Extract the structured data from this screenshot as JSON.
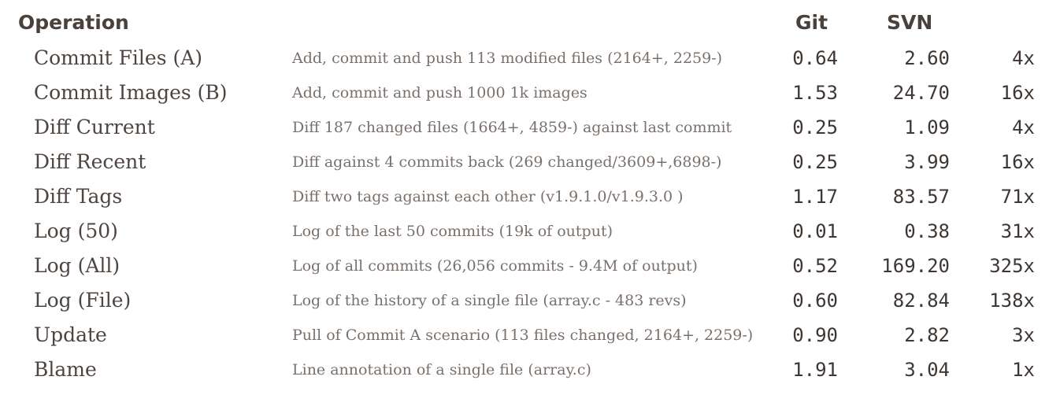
{
  "header": {
    "operation": "Operation",
    "git": "Git",
    "svn": "SVN"
  },
  "rows": [
    {
      "operation": "Commit Files (A)",
      "description": "Add, commit and push 113 modified files (2164+, 2259-)",
      "git": "0.64",
      "svn": "2.60",
      "ratio": "4x"
    },
    {
      "operation": "Commit Images (B)",
      "description": "Add, commit and push 1000 1k images",
      "git": "1.53",
      "svn": "24.70",
      "ratio": "16x"
    },
    {
      "operation": "Diff Current",
      "description": "Diff 187 changed files (1664+, 4859-) against last commit",
      "git": "0.25",
      "svn": "1.09",
      "ratio": "4x"
    },
    {
      "operation": "Diff Recent",
      "description": "Diff against 4 commits back (269 changed/3609+,6898-)",
      "git": "0.25",
      "svn": "3.99",
      "ratio": "16x"
    },
    {
      "operation": "Diff Tags",
      "description": "Diff two tags against each other (v1.9.1.0/v1.9.3.0 )",
      "git": "1.17",
      "svn": "83.57",
      "ratio": "71x"
    },
    {
      "operation": "Log (50)",
      "description": "Log of the last 50 commits (19k of output)",
      "git": "0.01",
      "svn": "0.38",
      "ratio": "31x"
    },
    {
      "operation": "Log (All)",
      "description": "Log of all commits (26,056 commits - 9.4M of output)",
      "git": "0.52",
      "svn": "169.20",
      "ratio": "325x"
    },
    {
      "operation": "Log (File)",
      "description": "Log of the history of a single file (array.c - 483 revs)",
      "git": "0.60",
      "svn": "82.84",
      "ratio": "138x"
    },
    {
      "operation": "Update",
      "description": "Pull of Commit A scenario (113 files changed, 2164+, 2259-)",
      "git": "0.90",
      "svn": "2.82",
      "ratio": "3x"
    },
    {
      "operation": "Blame",
      "description": "Line annotation of a single file (array.c)",
      "git": "1.91",
      "svn": "3.04",
      "ratio": "1x"
    }
  ]
}
